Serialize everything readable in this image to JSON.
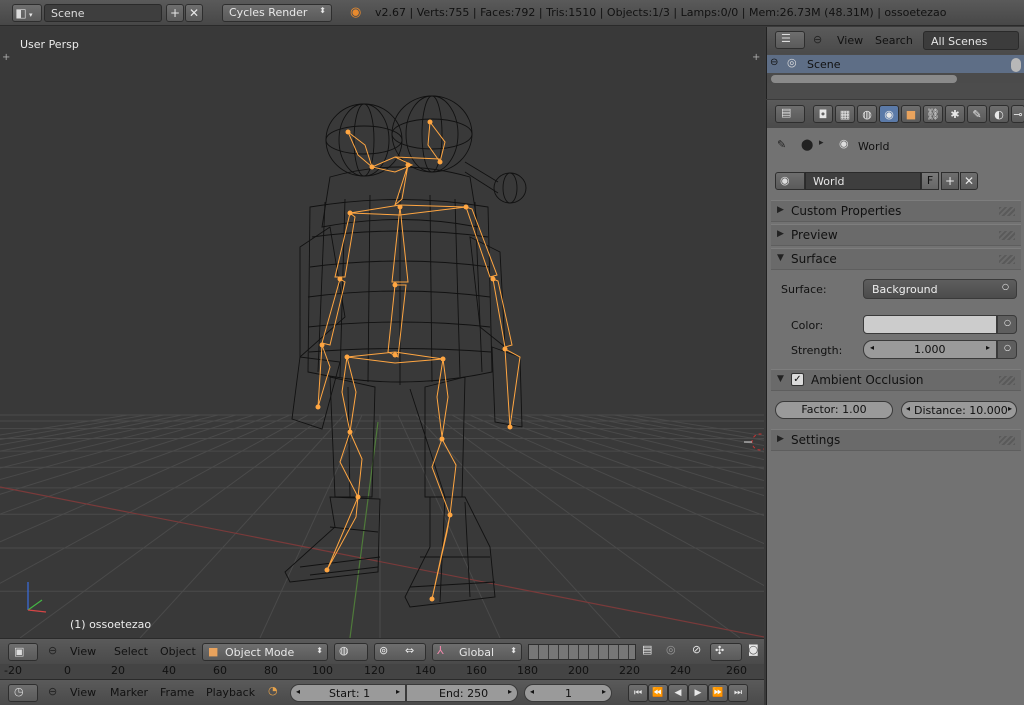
{
  "topbar": {
    "scene_label": "Scene",
    "renderer": "Cycles Render",
    "stats": "v2.67 | Verts:755 | Faces:792 | Tris:1510 | Objects:1/3 | Lamps:0/0 | Mem:26.73M (48.31M) | ossoetezao"
  },
  "viewport": {
    "view_label": "User Persp",
    "object_label": "(1) ossoetezao"
  },
  "viewport_header": {
    "menu_view": "View",
    "menu_select": "Select",
    "menu_object": "Object",
    "mode": "Object Mode",
    "orientation": "Global"
  },
  "timeline": {
    "ticks": [
      "-20",
      "0",
      "20",
      "40",
      "60",
      "80",
      "100",
      "120",
      "140",
      "160",
      "180",
      "200",
      "220",
      "240",
      "260"
    ],
    "menu_view": "View",
    "menu_marker": "Marker",
    "menu_frame": "Frame",
    "menu_playback": "Playback",
    "start": "Start: 1",
    "end": "End: 250",
    "current": "1"
  },
  "outliner": {
    "menu_view": "View",
    "menu_search": "Search",
    "filter": "All Scenes",
    "row_scene": "Scene"
  },
  "properties": {
    "breadcrumb": "World",
    "world_name": "World",
    "fake_user": "F",
    "panels": {
      "custom_properties": "Custom Properties",
      "preview": "Preview",
      "surface": "Surface",
      "ambient_occlusion": "Ambient Occlusion",
      "settings": "Settings"
    },
    "surface": {
      "surface_label": "Surface:",
      "surface_value": "Background",
      "color_label": "Color:",
      "strength_label": "Strength:",
      "strength_value": "1.000"
    },
    "ao": {
      "factor": "Factor: 1.00",
      "distance": "Distance: 10.000"
    }
  },
  "colors": {
    "bone": "#ffa642",
    "wire": "#111111",
    "grid": "#4d4d4d",
    "x_axis": "#7a3a3a",
    "y_axis": "#4f7a3a",
    "selected_row": "#5e6e86",
    "color_swatch": "#cccccc"
  }
}
